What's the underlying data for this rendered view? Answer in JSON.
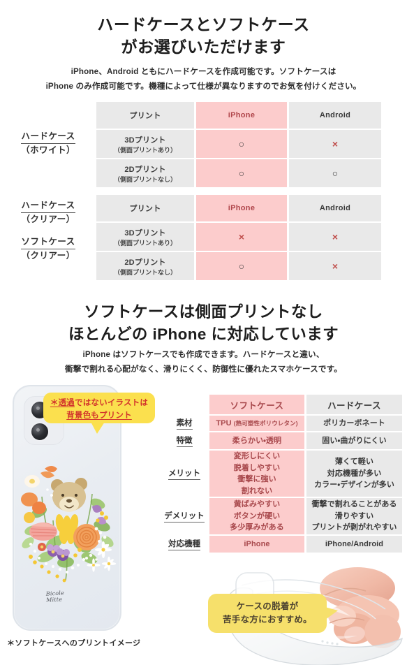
{
  "section1": {
    "headline_line1": "ハードケースとソフトケース",
    "headline_line2": "がお選びいただけます",
    "subcopy_line1": "iPhone、Android ともにハードケースを作成可能です。ソフトケースは",
    "subcopy_line2": "iPhone のみ作成可能です。機種によって仕様が異なりますのでお気を付けください。"
  },
  "table1": {
    "side_label_line1": "ハードケース",
    "side_label_line2": "（ホワイト）",
    "headers": [
      "プリント",
      "iPhone",
      "Android"
    ],
    "rows": [
      {
        "label_main": "3Dプリント",
        "label_sub": "（側面プリントあり）",
        "iphone": "○",
        "android": "×"
      },
      {
        "label_main": "2Dプリント",
        "label_sub": "（側面プリントなし）",
        "iphone": "○",
        "android": "○"
      }
    ]
  },
  "table2": {
    "side_label_a_line1": "ハードケース",
    "side_label_a_line2": "（クリアー）",
    "side_label_b_line1": "ソフトケース",
    "side_label_b_line2": "（クリアー）",
    "headers": [
      "プリント",
      "iPhone",
      "Android"
    ],
    "rows": [
      {
        "label_main": "3Dプリント",
        "label_sub": "（側面プリントあり）",
        "iphone": "×",
        "android": "×"
      },
      {
        "label_main": "2Dプリント",
        "label_sub": "（側面プリントなし）",
        "iphone": "○",
        "android": "×"
      }
    ]
  },
  "section2": {
    "headline_line1": "ソフトケースは側面プリントなし",
    "headline_line2": "ほとんどの iPhone に対応しています",
    "subcopy_line1": "iPhone はソフトケースでも作成できます。ハードケースと違い、",
    "subcopy_line2": "衝撃で割れる心配がなく、滑りにくく、防御性に優れたスマホケースです。"
  },
  "compare_table": {
    "col_soft": "ソフトケース",
    "col_hard": "ハードケース",
    "rows": [
      {
        "label": "素材",
        "soft_main": "TPU ",
        "soft_sub": "(熱可塑性ポリウレタン)",
        "hard": "ポリカーボネート"
      },
      {
        "label": "特徴",
        "soft": "柔らかい・透明",
        "hard": "固い・曲がりにくい"
      },
      {
        "label": "メリット",
        "soft_lines": [
          "変形しにくい",
          "脱着しやすい",
          "衝撃に強い",
          "割れない"
        ],
        "hard_lines": [
          "薄くて軽い",
          "対応機種が多い",
          "カラー・デザインが多い"
        ]
      },
      {
        "label": "デメリット",
        "soft_lines": [
          "黄ばみやすい",
          "ボタンが硬い",
          "多少厚みがある"
        ],
        "hard_lines": [
          "衝撃で割れることがある",
          "滑りやすい",
          "プリントが剥がれやすい"
        ]
      },
      {
        "label": "対応機種",
        "soft": "iPhone",
        "hard": "iPhone/Android"
      }
    ]
  },
  "bubble_yellow": {
    "line1_a": "＊透過",
    "line1_b": "ではないイラストは",
    "line2": "背景色もプリント"
  },
  "bubble_bottom": {
    "line1": "ケースの脱着が",
    "line2": "苦手な方におすすめ。"
  },
  "phone_art": {
    "signature_line1": "Bicole",
    "signature_line2": "Mitte"
  },
  "footnote": "＊ソフトケースへのプリントイメージ",
  "colors": {
    "pink": "#fccccc",
    "gray": "#e9e9e9",
    "pink_text": "#b0464b",
    "mark_x": "#c0504d",
    "bubble_yellow": "#fbe04e",
    "bubble_bottom": "#f6e06b",
    "bubble_text_red": "#d2342c"
  }
}
